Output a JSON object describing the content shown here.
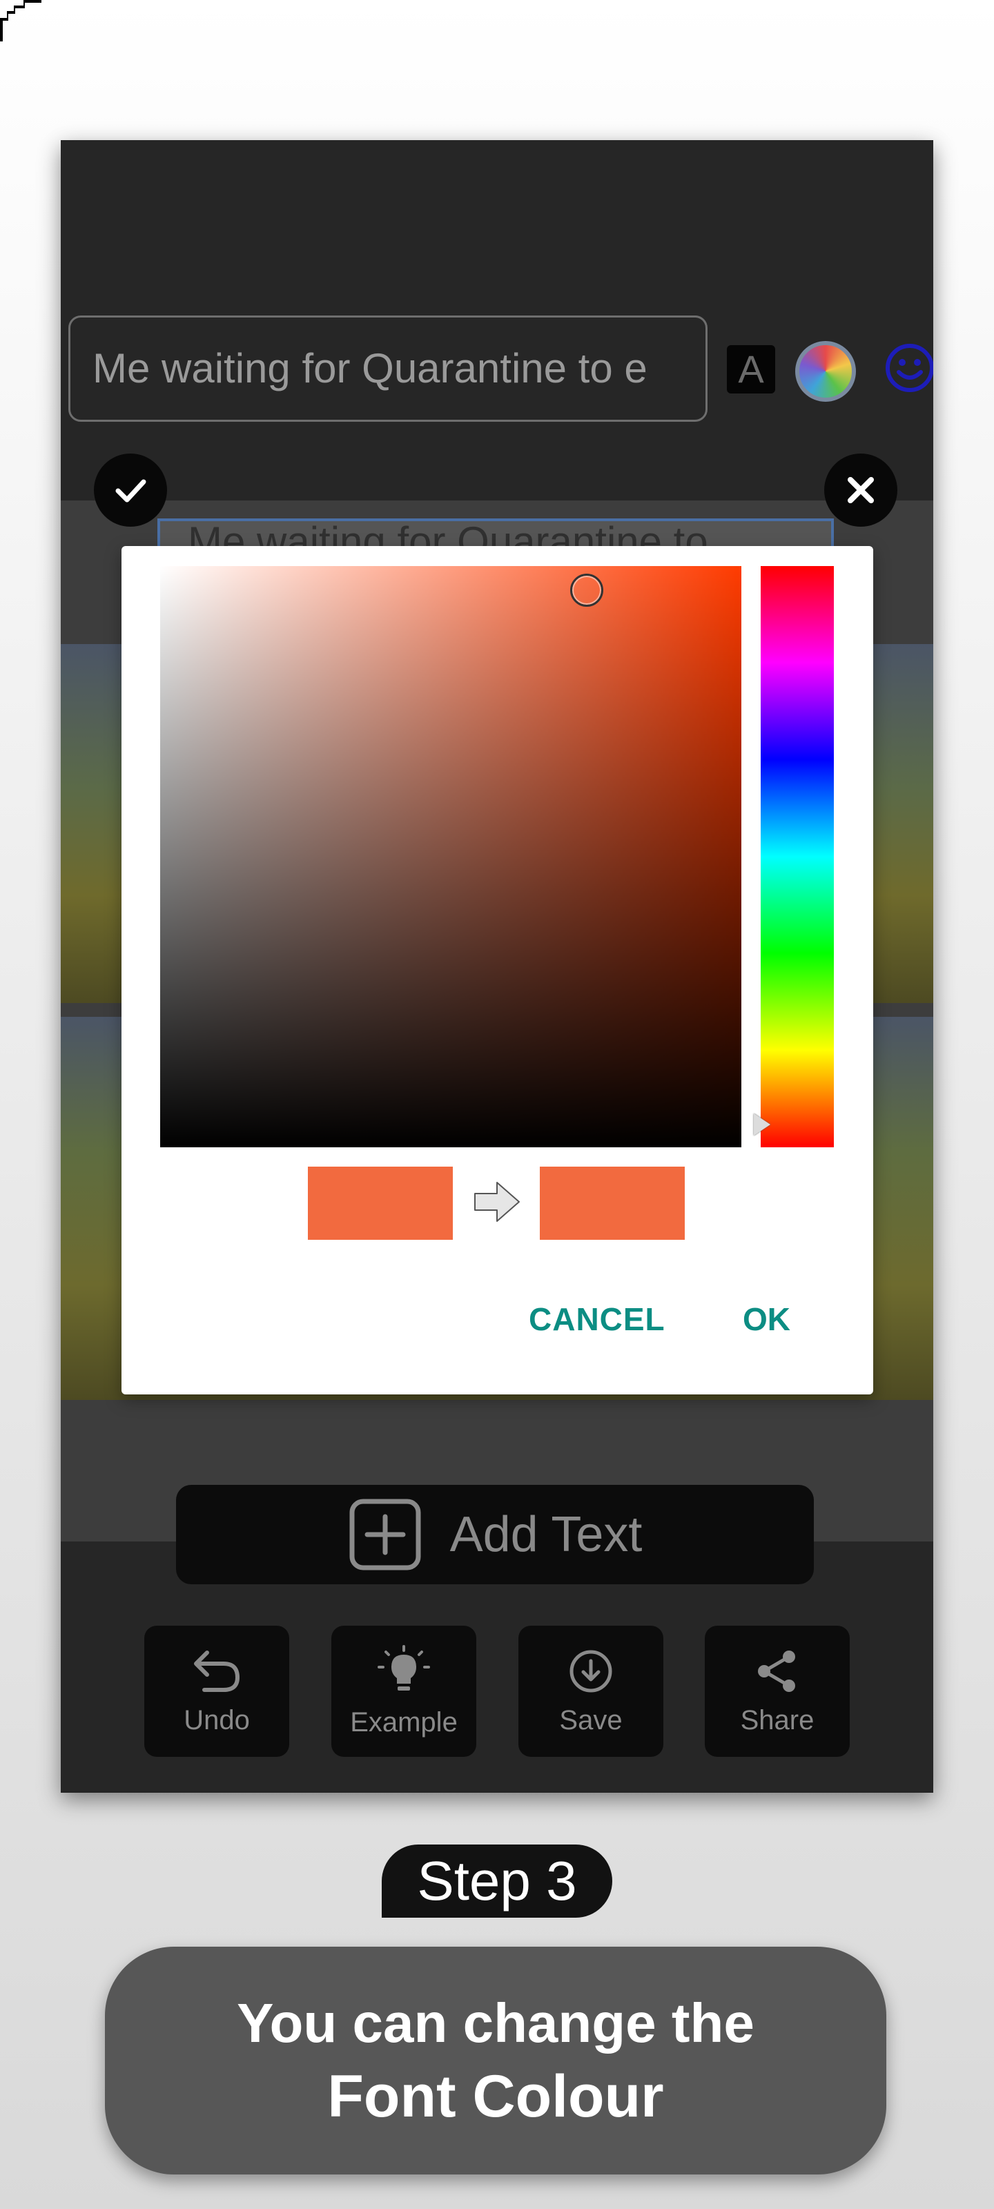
{
  "editor": {
    "text_input_value": "Me waiting for Quarantine to e",
    "font_style_glyph": "A",
    "caption_preview": "Me waiting for Quarantine to"
  },
  "toolbar": {
    "add_text_label": "Add Text",
    "tools": [
      {
        "label": "Undo",
        "icon": "undo-icon"
      },
      {
        "label": "Example",
        "icon": "lightbulb-icon"
      },
      {
        "label": "Save",
        "icon": "download-icon"
      },
      {
        "label": "Share",
        "icon": "share-icon"
      }
    ]
  },
  "color_dialog": {
    "selected_color": "#f26a3f",
    "previous_color": "#f26a3f",
    "hue_color": "#ff3b00",
    "cancel_label": "CANCEL",
    "ok_label": "OK"
  },
  "step": {
    "badge": "Step 3",
    "line1": "You can change the",
    "line2": "Font Colour"
  },
  "colors": {
    "accent_teal": "#0c8d83",
    "phone_bg": "#262626",
    "caption_card_bg": "#575757"
  }
}
